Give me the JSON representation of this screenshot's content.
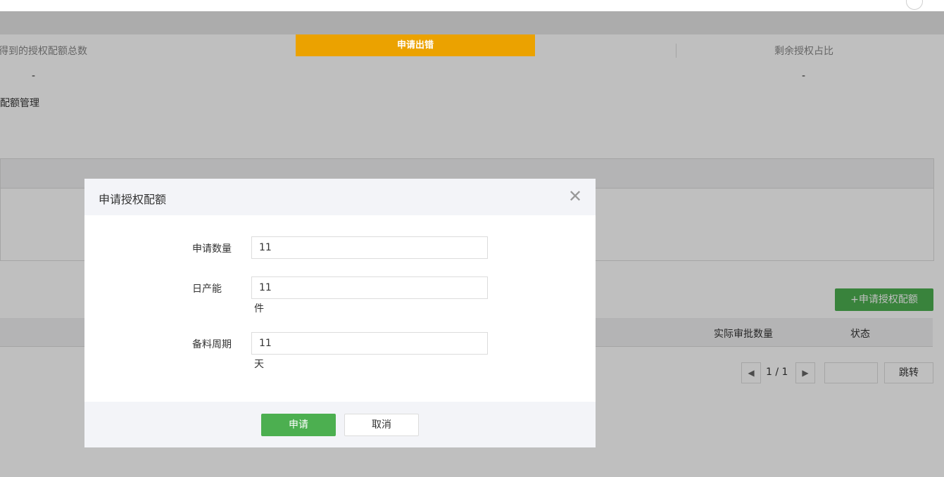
{
  "toast": {
    "message": "申请出错"
  },
  "breadcrumb": {
    "text": "配额管理"
  },
  "stats": {
    "col1_label": "得到的授权配额总数",
    "col1_value": "-",
    "col2_label": "剩余授权占比",
    "col2_value": "-"
  },
  "actions": {
    "add_label": "+申请授权配额"
  },
  "table": {
    "headers": [
      "实际审批数量",
      "状态"
    ]
  },
  "pagination": {
    "prev_icon": "◀",
    "next_icon": "▶",
    "page_text": "1 / 1",
    "jump_label": "跳转"
  },
  "modal": {
    "title": "申请授权配额",
    "close_icon": "✕",
    "fields": [
      {
        "label": "申请数量",
        "value": "11",
        "unit": ""
      },
      {
        "label": "日产能",
        "value": "11",
        "unit": "件"
      },
      {
        "label": "备料周期",
        "value": "11",
        "unit": "天"
      }
    ],
    "submit_label": "申请",
    "cancel_label": "取消"
  },
  "colors": {
    "accent_green": "#4caf50",
    "toast_orange": "#eba200"
  }
}
